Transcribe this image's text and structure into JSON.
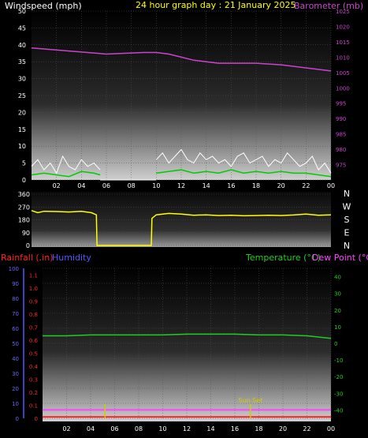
{
  "header": {
    "wind_label": "Windspeed (mph)",
    "title": "24 hour graph day : 21 January 2025",
    "baro_label": "Barometer (mb)"
  },
  "lower_header": {
    "rain_label": "Rainfall (.in)",
    "humidity_label": "Humidity",
    "temp_label": "Temperature (°C)",
    "dew_label": "Dew Point (°C)"
  },
  "colors": {
    "background": "#000000",
    "wind_speed": "#ffffff",
    "wind_avg": "#00cc00",
    "barometer": "#cc44cc",
    "direction": "#ffff00",
    "rainfall": "#ff2222",
    "humidity": "#5555ff",
    "temperature": "#22cc22",
    "dew_point": "#ff44ff",
    "sun_marker": "#cccc00"
  },
  "chart_data": [
    {
      "type": "line",
      "name": "wind-barometer",
      "title": "24 hour graph day : 21 January 2025",
      "xticks": [
        "02",
        "04",
        "06",
        "08",
        "10",
        "12",
        "14",
        "16",
        "18",
        "20",
        "22",
        "00"
      ],
      "xlim_hours": [
        0,
        24
      ],
      "left_axis": {
        "label": "Windspeed (mph)",
        "ylim": [
          0,
          50
        ],
        "ticks": [
          0,
          5,
          10,
          15,
          20,
          25,
          30,
          35,
          40,
          45,
          50
        ]
      },
      "right_axis": {
        "label": "Barometer (mb)",
        "ylim": [
          970,
          1025
        ],
        "ticks": [
          975,
          980,
          985,
          990,
          995,
          1000,
          1005,
          1010,
          1015,
          1020,
          1025
        ]
      },
      "series": [
        {
          "kind": "barometer",
          "x": [
            0,
            3,
            6,
            9,
            10,
            11,
            12,
            13,
            14,
            15,
            16,
            18,
            20,
            22,
            24
          ],
          "y": [
            1013,
            1012,
            1011,
            1011.5,
            1011.5,
            1011,
            1010,
            1009,
            1008.5,
            1008,
            1008,
            1008,
            1007.5,
            1006.5,
            1005.5
          ]
        },
        {
          "kind": "wind_gust",
          "segments": [
            {
              "x": [
                0,
                0.5,
                1,
                1.5,
                2,
                2.5,
                3,
                3.5,
                4,
                4.5,
                5,
                5.5
              ],
              "y": [
                4,
                6,
                3,
                5,
                2,
                7,
                4,
                3,
                6,
                4,
                5,
                3
              ]
            },
            {
              "x": [
                10,
                10.5,
                11,
                11.5,
                12,
                12.5,
                13,
                13.5,
                14,
                14.5,
                15,
                15.5,
                16,
                16.5,
                17,
                17.5,
                18,
                18.5,
                19,
                19.5,
                20,
                20.5,
                21,
                21.5,
                22,
                22.5,
                23,
                23.5,
                24
              ],
              "y": [
                6,
                8,
                5,
                7,
                9,
                6,
                5,
                8,
                6,
                7,
                5,
                6,
                4,
                7,
                8,
                5,
                6,
                7,
                4,
                6,
                5,
                8,
                6,
                4,
                5,
                7,
                3,
                5,
                2
              ]
            }
          ]
        },
        {
          "kind": "wind_avg",
          "segments": [
            {
              "x": [
                0,
                1,
                2,
                3,
                4,
                5,
                5.5
              ],
              "y": [
                1.5,
                2,
                1.5,
                1,
                2.5,
                2,
                1.5
              ]
            },
            {
              "x": [
                10,
                11,
                12,
                13,
                14,
                15,
                16,
                17,
                18,
                19,
                20,
                21,
                22,
                23,
                24
              ],
              "y": [
                2,
                2.5,
                3,
                2,
                2.5,
                2,
                3,
                2,
                2.5,
                2,
                2.5,
                2,
                2,
                1.5,
                1
              ]
            }
          ]
        },
        {
          "kind": "wind_zero",
          "x": [
            5.5,
            10
          ],
          "y": [
            0,
            0
          ]
        }
      ]
    },
    {
      "type": "line",
      "name": "wind-direction",
      "xlim_hours": [
        0,
        24
      ],
      "ylim": [
        0,
        360
      ],
      "ticks": [
        0,
        90,
        180,
        270,
        360
      ],
      "compass": [
        "N",
        "W",
        "S",
        "E",
        "N"
      ],
      "series": [
        {
          "name": "direction",
          "x": [
            0,
            0.5,
            1,
            2,
            3,
            4,
            4.8,
            5.2,
            5.25,
            9.6,
            9.65,
            10,
            11,
            12,
            13,
            14,
            15,
            16,
            17,
            18,
            19,
            20,
            21,
            22,
            23,
            24
          ],
          "y": [
            245,
            230,
            240,
            238,
            235,
            240,
            230,
            215,
            0,
            0,
            190,
            215,
            225,
            220,
            212,
            215,
            210,
            212,
            208,
            210,
            212,
            210,
            214,
            220,
            212,
            215
          ]
        }
      ]
    },
    {
      "type": "line",
      "name": "temperature-humidity-rain",
      "xticks": [
        "02",
        "04",
        "06",
        "08",
        "10",
        "12",
        "14",
        "16",
        "18",
        "20",
        "22",
        "00"
      ],
      "xlim_hours": [
        0,
        24
      ],
      "left_axis_humidity": {
        "label": "Humidity",
        "ylim": [
          0,
          100
        ],
        "ticks": [
          0,
          10,
          20,
          30,
          40,
          50,
          60,
          70,
          80,
          90,
          100
        ]
      },
      "left_axis_rain": {
        "label": "Rainfall (.in)",
        "ylim": [
          0,
          1.15
        ],
        "ticks": [
          0,
          0.1,
          0.2,
          0.3,
          0.4,
          0.5,
          0.6,
          0.7,
          0.8,
          0.9,
          1,
          1.1
        ]
      },
      "right_axis": {
        "label": "Temperature (°C)",
        "ylim": [
          -45,
          45
        ],
        "ticks": [
          -40,
          -30,
          -20,
          -10,
          0,
          10,
          20,
          30,
          40
        ]
      },
      "series": [
        {
          "name": "Temperature (°C)",
          "x": [
            0,
            2,
            4,
            6,
            8,
            10,
            12,
            14,
            16,
            18,
            20,
            22,
            24
          ],
          "y": [
            4.5,
            4.5,
            5,
            5,
            5,
            5,
            5.5,
            5.5,
            5.5,
            5,
            5,
            4.5,
            3
          ]
        },
        {
          "name": "Dew Point (°C)",
          "x": [
            0,
            6,
            12,
            18,
            24
          ],
          "y": [
            -40,
            -40,
            -40,
            -40,
            -40
          ]
        },
        {
          "name": "Rainfall (.in)",
          "x": [
            0,
            24
          ],
          "y": [
            0.01,
            0.01
          ]
        }
      ],
      "annotations": [
        {
          "text": "Sun Set",
          "x_hours": 17.3
        },
        {
          "text": "",
          "x_hours": 5.2
        }
      ]
    }
  ]
}
